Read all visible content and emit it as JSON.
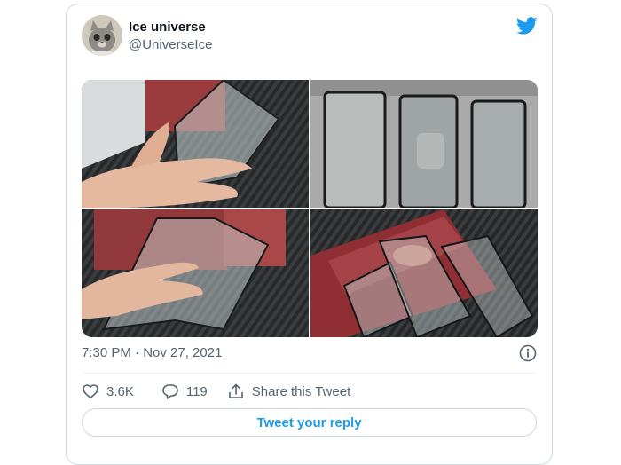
{
  "tweet": {
    "author_name": "Ice universe",
    "author_handle": "@UniverseIce",
    "timestamp": "7:30 PM · Nov 27, 2021",
    "likes": "3.6K",
    "replies": "119",
    "share_label": "Share this Tweet",
    "reply_button_label": "Tweet your reply",
    "icons": {
      "brand": "twitter-bird-icon",
      "info": "info-icon",
      "like": "heart-icon",
      "reply": "reply-bubble-icon",
      "share": "share-icon"
    }
  },
  "media": {
    "count": 4,
    "photos": [
      "hand holding curved glass screen protector",
      "three screen protectors in packaging",
      "hand holding screen protector over leather case",
      "screen protectors laid on red leather case"
    ]
  },
  "colors": {
    "accent": "#1d9bf0",
    "text_primary": "#0f1419",
    "text_secondary": "#536471",
    "border": "#cfd9de"
  }
}
